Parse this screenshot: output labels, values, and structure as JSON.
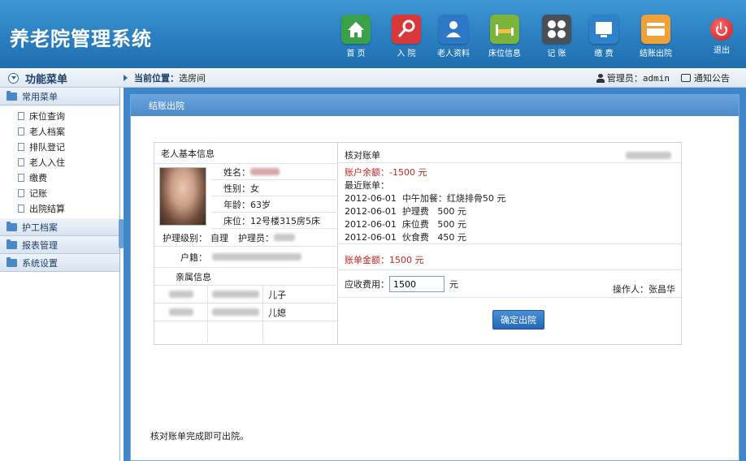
{
  "app": {
    "title": "养老院管理系统"
  },
  "nav": [
    {
      "label": "首 页",
      "icon": "home-icon",
      "color": "#3aa14a"
    },
    {
      "label": "入 院",
      "icon": "key-icon",
      "color": "#d8383a"
    },
    {
      "label": "老人资料",
      "icon": "person-icon",
      "color": "#2f78c7"
    },
    {
      "label": "床位信息",
      "icon": "bed-icon",
      "color": "#7cb33a"
    },
    {
      "label": "记 账",
      "icon": "calculator-icon",
      "color": "#4a4f57"
    },
    {
      "label": "缴 费",
      "icon": "monitor-icon",
      "color": "#2f82c9"
    },
    {
      "label": "结账出院",
      "icon": "card-icon",
      "color": "#f0a23a"
    }
  ],
  "exit_label": "退出",
  "sidebar": {
    "title": "功能菜单",
    "groups": [
      {
        "label": "常用菜单",
        "items": [
          "床位查询",
          "老人档案",
          "排队登记",
          "老人入住",
          "缴费",
          "记账",
          "出院结算"
        ]
      },
      {
        "label": "护工档案"
      },
      {
        "label": "报表管理"
      },
      {
        "label": "系统设置"
      }
    ]
  },
  "breadcrumb": {
    "label": "当前位置：",
    "value": "选房间"
  },
  "user": {
    "label": "管理员：",
    "name": "admin",
    "notice": "通知公告"
  },
  "panel": {
    "title": "结账出院",
    "note": "核对账单完成即可出院。"
  },
  "elder": {
    "section_title": "老人基本信息",
    "name_label": "姓名：",
    "gender_label": "性别：",
    "gender": "女",
    "age_label": "年龄：",
    "age": "63岁",
    "bed_label": "床位：",
    "bed": "12号楼315房5床",
    "care_level_label": "护理级别：",
    "care_level": "自理",
    "caregiver_label": "护理员：",
    "hukou_label": "户籍：",
    "relatives_title": "亲属信息",
    "relatives": [
      {
        "relation": "儿子"
      },
      {
        "relation": "儿媳"
      }
    ]
  },
  "bill": {
    "title": "核对账单",
    "balance_label": "账户余额：",
    "balance": "-1500 元",
    "recent_label": "最近账单：",
    "entries": [
      "2012-06-01  中午加餐：红烧排骨50 元",
      "2012-06-01  护理费   500 元",
      "2012-06-01  床位费   500 元",
      "2012-06-01  伙食费   450 元"
    ],
    "amount_label": "账单金额：",
    "amount": "1500 元",
    "fee_label": "应收费用：",
    "fee_value": "1500",
    "fee_unit": "元",
    "operator_label": "操作人：",
    "operator": "张昌华",
    "confirm_label": "确定出院"
  }
}
